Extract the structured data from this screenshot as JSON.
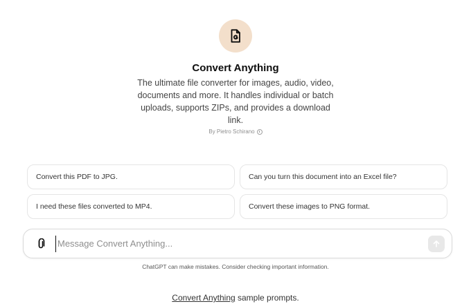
{
  "gpt": {
    "name": "Convert Anything",
    "description": "The ultimate file converter for images, audio, video, documents and more. It handles individual or batch uploads, supports ZIPs, and provides a download link.",
    "author": "By Pietro Schirano",
    "avatar_icon": "file-convert-icon",
    "avatar_color": "#f3dfcb"
  },
  "prompts": [
    {
      "label": "Convert this PDF to JPG."
    },
    {
      "label": "Can you turn this document into an Excel file?"
    },
    {
      "label": "I need these files converted to MP4."
    },
    {
      "label": "Convert these images to PNG format."
    }
  ],
  "composer": {
    "placeholder": "Message Convert Anything...",
    "attach_icon": "paperclip-icon",
    "send_icon": "arrow-up-icon"
  },
  "disclaimer": "ChatGPT can make mistakes. Consider checking important information.",
  "caption": {
    "link_text": "Convert Anything",
    "rest_text": " sample prompts."
  }
}
